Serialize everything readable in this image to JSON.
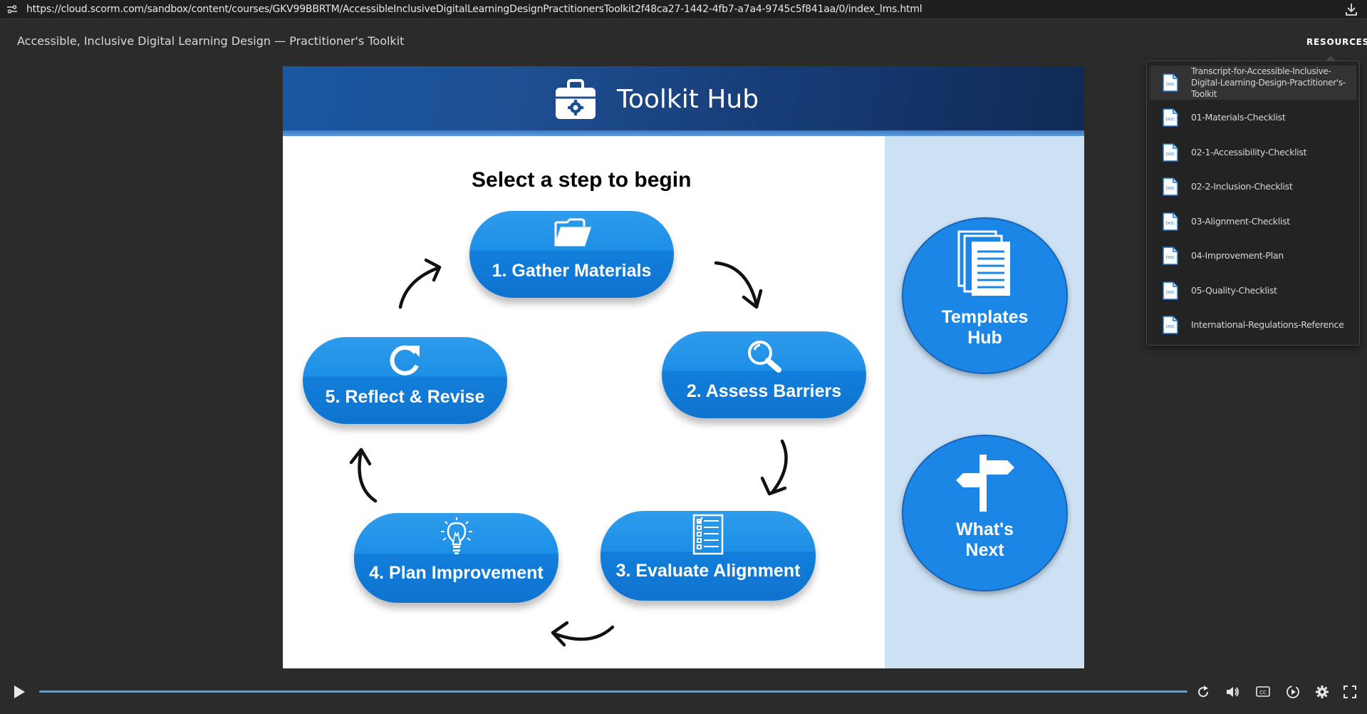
{
  "browser": {
    "url": "https://cloud.scorm.com/sandbox/content/courses/GKV99BBRTM/AccessibleInclusiveDigitalLearningDesignPractitionersToolkit2f48ca27-1442-4fb7-a7a4-9745c5f841aa/0/index_lms.html"
  },
  "header": {
    "course_title": "Accessible, Inclusive Digital Learning Design — Practitioner's Toolkit",
    "resources_label": "RESOURCES"
  },
  "resources": {
    "items": [
      {
        "label_lines": [
          "Transcript-for-Accessible-Inclusive-",
          "Digital-Learning-Design-Practitioner's-",
          "Toolkit"
        ],
        "icon": "doc-icon"
      },
      {
        "label": "01-Materials-Checklist",
        "icon": "doc-icon"
      },
      {
        "label": "02-1-Accessibility-Checklist",
        "icon": "doc-icon"
      },
      {
        "label": "02-2-Inclusion-Checklist",
        "icon": "doc-icon"
      },
      {
        "label": "03-Alignment-Checklist",
        "icon": "doc-icon"
      },
      {
        "label": "04-Improvement-Plan",
        "icon": "doc-icon"
      },
      {
        "label": "05-Quality-Checklist",
        "icon": "doc-icon"
      },
      {
        "label": "International-Regulations-Reference",
        "icon": "doc-icon"
      }
    ]
  },
  "slide": {
    "title": "Toolkit Hub",
    "heading": "Select a step to begin",
    "steps": [
      {
        "label": "1. Gather Materials",
        "icon": "folder-icon"
      },
      {
        "label": "2. Assess Barriers",
        "icon": "magnifier-icon"
      },
      {
        "label": "3. Evaluate Alignment",
        "icon": "checklist-icon"
      },
      {
        "label": "4. Plan Improvement",
        "icon": "lightbulb-icon"
      },
      {
        "label": "5. Reflect & Revise",
        "icon": "refresh-icon"
      }
    ],
    "hubs": [
      {
        "line1": "Templates",
        "line2": "Hub",
        "icon": "documents-icon"
      },
      {
        "line1": "What's",
        "line2": "Next",
        "icon": "signpost-icon"
      }
    ]
  },
  "player": {
    "progress_fraction": 1.0
  },
  "colors": {
    "step_blue": "#1d8fe6",
    "side_panel": "#cde1f4",
    "header_dark": "#173d78",
    "progress": "#4da3e8"
  }
}
